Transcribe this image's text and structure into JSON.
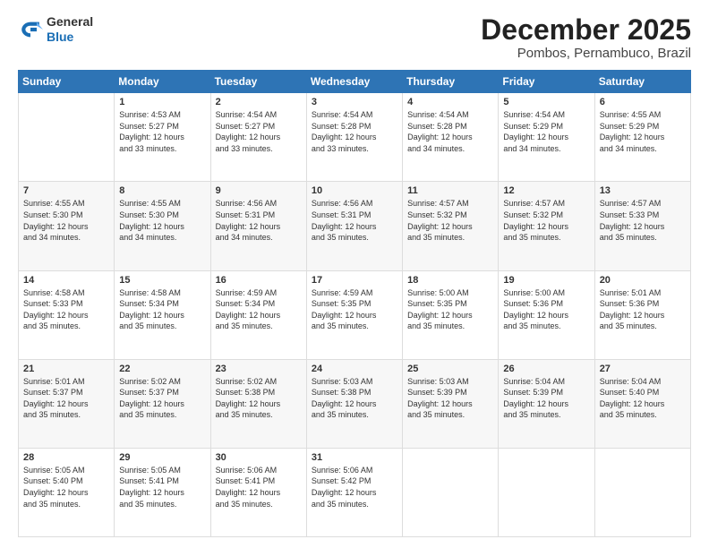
{
  "logo": {
    "general": "General",
    "blue": "Blue"
  },
  "header": {
    "month": "December 2025",
    "location": "Pombos, Pernambuco, Brazil"
  },
  "weekdays": [
    "Sunday",
    "Monday",
    "Tuesday",
    "Wednesday",
    "Thursday",
    "Friday",
    "Saturday"
  ],
  "weeks": [
    [
      {
        "day": null,
        "info": null
      },
      {
        "day": "1",
        "sunrise": "4:53 AM",
        "sunset": "5:27 PM",
        "daylight": "12 hours and 33 minutes."
      },
      {
        "day": "2",
        "sunrise": "4:54 AM",
        "sunset": "5:27 PM",
        "daylight": "12 hours and 33 minutes."
      },
      {
        "day": "3",
        "sunrise": "4:54 AM",
        "sunset": "5:28 PM",
        "daylight": "12 hours and 33 minutes."
      },
      {
        "day": "4",
        "sunrise": "4:54 AM",
        "sunset": "5:28 PM",
        "daylight": "12 hours and 34 minutes."
      },
      {
        "day": "5",
        "sunrise": "4:54 AM",
        "sunset": "5:29 PM",
        "daylight": "12 hours and 34 minutes."
      },
      {
        "day": "6",
        "sunrise": "4:55 AM",
        "sunset": "5:29 PM",
        "daylight": "12 hours and 34 minutes."
      }
    ],
    [
      {
        "day": "7",
        "sunrise": "4:55 AM",
        "sunset": "5:30 PM",
        "daylight": "12 hours and 34 minutes."
      },
      {
        "day": "8",
        "sunrise": "4:55 AM",
        "sunset": "5:30 PM",
        "daylight": "12 hours and 34 minutes."
      },
      {
        "day": "9",
        "sunrise": "4:56 AM",
        "sunset": "5:31 PM",
        "daylight": "12 hours and 34 minutes."
      },
      {
        "day": "10",
        "sunrise": "4:56 AM",
        "sunset": "5:31 PM",
        "daylight": "12 hours and 35 minutes."
      },
      {
        "day": "11",
        "sunrise": "4:57 AM",
        "sunset": "5:32 PM",
        "daylight": "12 hours and 35 minutes."
      },
      {
        "day": "12",
        "sunrise": "4:57 AM",
        "sunset": "5:32 PM",
        "daylight": "12 hours and 35 minutes."
      },
      {
        "day": "13",
        "sunrise": "4:57 AM",
        "sunset": "5:33 PM",
        "daylight": "12 hours and 35 minutes."
      }
    ],
    [
      {
        "day": "14",
        "sunrise": "4:58 AM",
        "sunset": "5:33 PM",
        "daylight": "12 hours and 35 minutes."
      },
      {
        "day": "15",
        "sunrise": "4:58 AM",
        "sunset": "5:34 PM",
        "daylight": "12 hours and 35 minutes."
      },
      {
        "day": "16",
        "sunrise": "4:59 AM",
        "sunset": "5:34 PM",
        "daylight": "12 hours and 35 minutes."
      },
      {
        "day": "17",
        "sunrise": "4:59 AM",
        "sunset": "5:35 PM",
        "daylight": "12 hours and 35 minutes."
      },
      {
        "day": "18",
        "sunrise": "5:00 AM",
        "sunset": "5:35 PM",
        "daylight": "12 hours and 35 minutes."
      },
      {
        "day": "19",
        "sunrise": "5:00 AM",
        "sunset": "5:36 PM",
        "daylight": "12 hours and 35 minutes."
      },
      {
        "day": "20",
        "sunrise": "5:01 AM",
        "sunset": "5:36 PM",
        "daylight": "12 hours and 35 minutes."
      }
    ],
    [
      {
        "day": "21",
        "sunrise": "5:01 AM",
        "sunset": "5:37 PM",
        "daylight": "12 hours and 35 minutes."
      },
      {
        "day": "22",
        "sunrise": "5:02 AM",
        "sunset": "5:37 PM",
        "daylight": "12 hours and 35 minutes."
      },
      {
        "day": "23",
        "sunrise": "5:02 AM",
        "sunset": "5:38 PM",
        "daylight": "12 hours and 35 minutes."
      },
      {
        "day": "24",
        "sunrise": "5:03 AM",
        "sunset": "5:38 PM",
        "daylight": "12 hours and 35 minutes."
      },
      {
        "day": "25",
        "sunrise": "5:03 AM",
        "sunset": "5:39 PM",
        "daylight": "12 hours and 35 minutes."
      },
      {
        "day": "26",
        "sunrise": "5:04 AM",
        "sunset": "5:39 PM",
        "daylight": "12 hours and 35 minutes."
      },
      {
        "day": "27",
        "sunrise": "5:04 AM",
        "sunset": "5:40 PM",
        "daylight": "12 hours and 35 minutes."
      }
    ],
    [
      {
        "day": "28",
        "sunrise": "5:05 AM",
        "sunset": "5:40 PM",
        "daylight": "12 hours and 35 minutes."
      },
      {
        "day": "29",
        "sunrise": "5:05 AM",
        "sunset": "5:41 PM",
        "daylight": "12 hours and 35 minutes."
      },
      {
        "day": "30",
        "sunrise": "5:06 AM",
        "sunset": "5:41 PM",
        "daylight": "12 hours and 35 minutes."
      },
      {
        "day": "31",
        "sunrise": "5:06 AM",
        "sunset": "5:42 PM",
        "daylight": "12 hours and 35 minutes."
      },
      {
        "day": null,
        "info": null
      },
      {
        "day": null,
        "info": null
      },
      {
        "day": null,
        "info": null
      }
    ]
  ]
}
